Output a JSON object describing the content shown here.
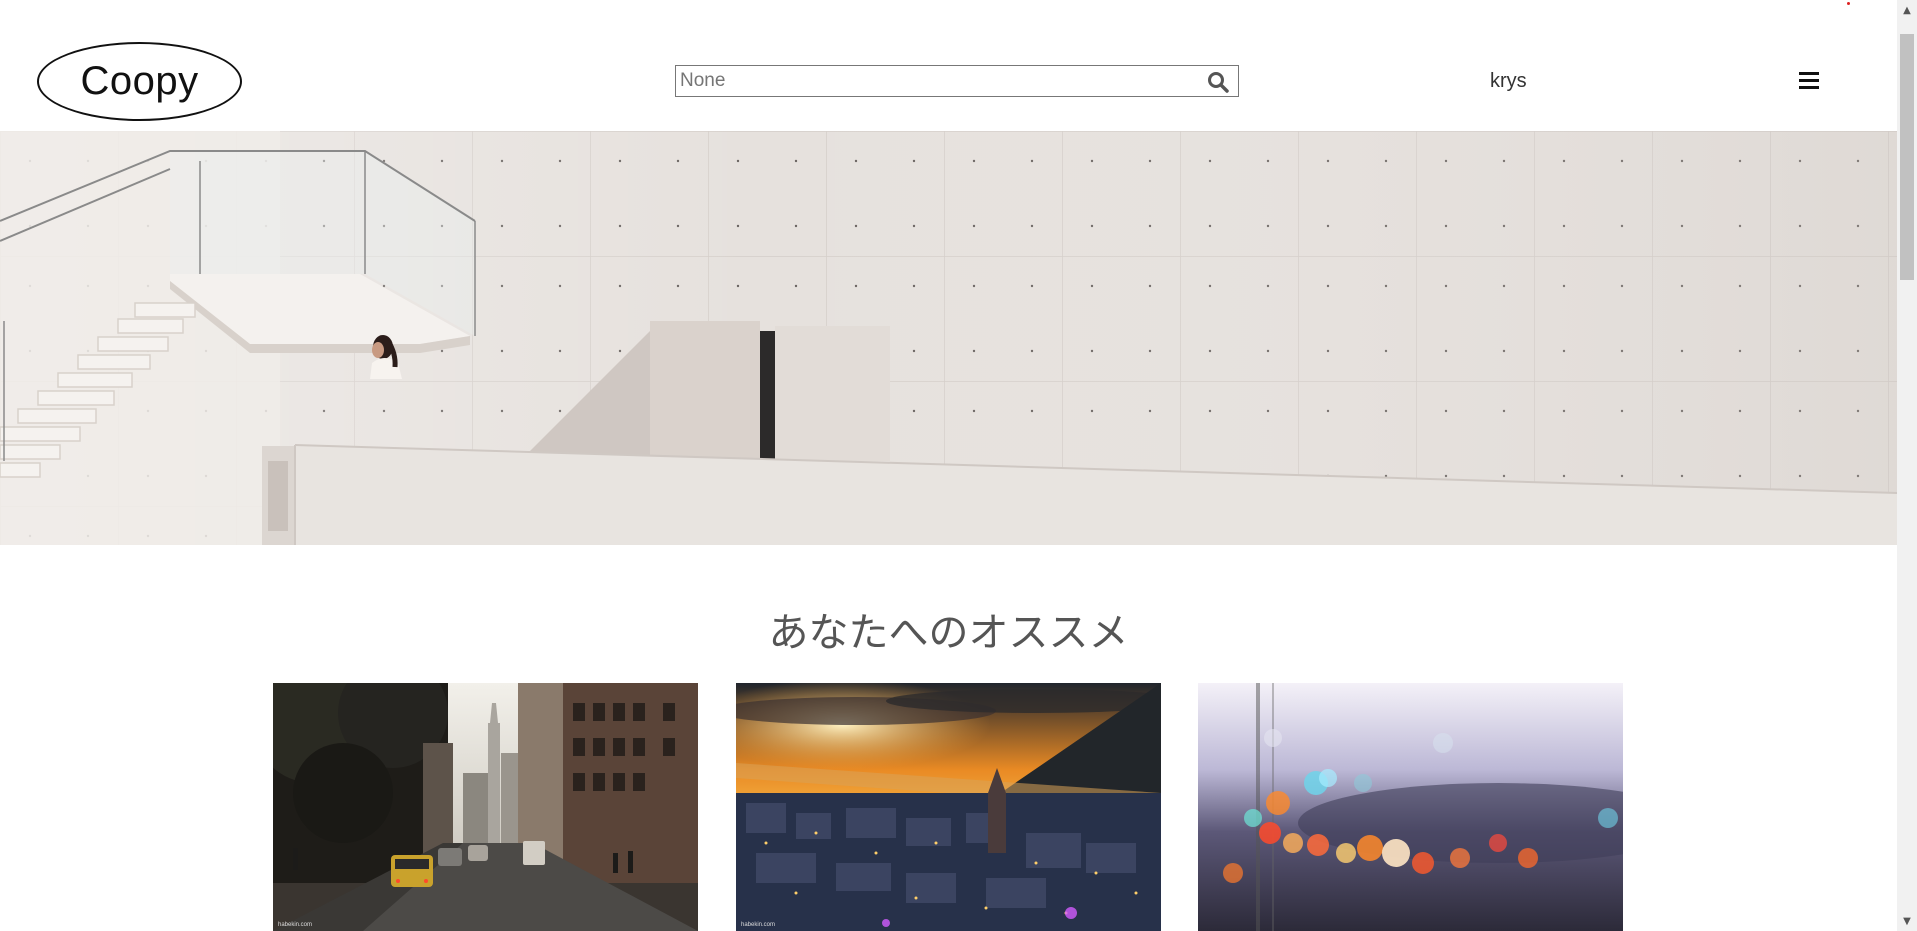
{
  "header": {
    "logo_text": "Coopy",
    "search_placeholder": "None",
    "search_icon": "search-icon",
    "user_name": "krys",
    "menu_icon": "hamburger-menu-icon"
  },
  "hero": {
    "image": "white-concrete-staircase-building-photo"
  },
  "recommendations": {
    "title": "あなたへのオススメ",
    "cards": [
      {
        "image": "city-street-photo",
        "credit": "habekin.com"
      },
      {
        "image": "sunset-city-aerial-photo",
        "credit": "habekin.com"
      },
      {
        "image": "bokeh-lights-photo"
      }
    ]
  },
  "scrollbar": {
    "up_arrow": "▲",
    "down_arrow": "▼"
  },
  "colors": {
    "text": "#333333",
    "hero_wall": "#e4dfdb",
    "title": "#555555"
  }
}
